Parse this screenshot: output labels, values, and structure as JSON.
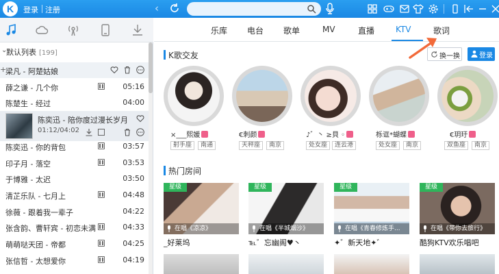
{
  "titlebar": {
    "login": "登录",
    "register": "注册",
    "search_placeholder": ""
  },
  "left": {
    "list_title": "默认列表",
    "list_count": "[199]",
    "songs": [
      {
        "name": "梁凡 - 阿楚姑娘",
        "dur": ""
      },
      {
        "name": "薛之谦 - 几个你",
        "dur": "05:16"
      },
      {
        "name": "陈楚生 - 经过",
        "dur": "04:00"
      },
      {
        "name": "陈奕迅 - 你的背包",
        "dur": "03:57"
      },
      {
        "name": "印子月 - 落空",
        "dur": "03:53"
      },
      {
        "name": "于博雅 - 太迟",
        "dur": "03:50"
      },
      {
        "name": "清芷乐队 - 七月上",
        "dur": "04:48"
      },
      {
        "name": "徐薇 - 跟着我一辈子",
        "dur": "04:22"
      },
      {
        "name": "张含韵、曹轩宾 - 初恋未满",
        "dur": "04:33"
      },
      {
        "name": "萌萌哒天团 - 帝都",
        "dur": "04:25"
      },
      {
        "name": "张信哲 - 太想爱你",
        "dur": "04:19"
      }
    ],
    "now_playing": {
      "title": "陈奕迅 - 陪你度过漫长岁月",
      "time": "01:12/04:02"
    }
  },
  "nav": {
    "items": [
      "乐库",
      "电台",
      "歌单",
      "MV",
      "直播",
      "KTV",
      "歌词"
    ],
    "active": "KTV"
  },
  "ktv": {
    "friends_title": "K歌交友",
    "swap_label": "换一换",
    "login_label": "登录",
    "friends": [
      {
        "name": "×___熙媛",
        "tags": [
          "射手座",
          "南通"
        ]
      },
      {
        "name": "€刺颜",
        "tags": [
          "天秤座",
          "南京"
        ]
      },
      {
        "name": "♪゛丶 ≥貝 ◦",
        "tags": [
          "处女座",
          "连云港"
        ]
      },
      {
        "name": "栎诓*蝴蝶",
        "tags": [
          "处女座",
          "南京"
        ]
      },
      {
        "name": "€玥玗",
        "tags": [
          "双鱼座",
          "南京"
        ]
      }
    ],
    "rooms_title": "热门房间",
    "badge_label": "星级",
    "rooms": [
      {
        "label": "在唱《凉凉》",
        "name": "_好莱坞"
      },
      {
        "label": "在唱《半城烟沙》",
        "name": "℡゛忘幽阁♥丶"
      },
      {
        "label": "在唱《青春修炼手...",
        "name": "✦゛新天地✦゛"
      },
      {
        "label": "在唱《带你去旅行》",
        "name": "酷狗KTV欢乐唱吧"
      }
    ]
  },
  "colors": {
    "accent": "#1a88e4",
    "badge_green": "#2fb55b",
    "female_pink": "#ef5f8a"
  }
}
